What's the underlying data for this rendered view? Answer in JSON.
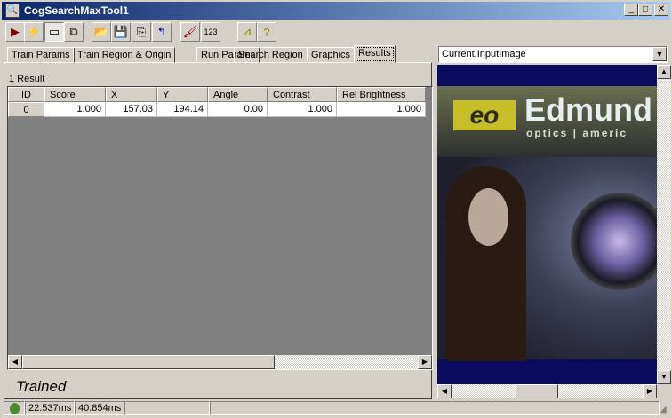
{
  "window": {
    "title": "CogSearchMaxTool1",
    "minimize": "_",
    "maximize": "□",
    "close": "✕"
  },
  "toolbar": [
    {
      "name": "run-icon",
      "glyph": "▶",
      "color": "#800000"
    },
    {
      "name": "electric-icon",
      "glyph": "⚡",
      "color": "#c0a000"
    },
    {
      "name": "show-controls-icon",
      "glyph": "▭",
      "color": "#000"
    },
    {
      "name": "floating-window-icon",
      "glyph": "⧉",
      "color": "#000"
    },
    {
      "name": "open-icon",
      "glyph": "📂",
      "color": "#806000"
    },
    {
      "name": "save-icon",
      "glyph": "💾",
      "color": "#000"
    },
    {
      "name": "save-as-icon",
      "glyph": "⎘",
      "color": "#000"
    },
    {
      "name": "reset-icon",
      "glyph": "↰",
      "color": "#0000a0"
    },
    {
      "name": "clear-icon",
      "glyph": "🖌",
      "color": "#a00000"
    },
    {
      "name": "numeric-display-icon",
      "glyph": "123",
      "color": "#000"
    },
    {
      "name": "edit-tool-icon",
      "glyph": "⊿",
      "color": "#808000"
    },
    {
      "name": "help-icon",
      "glyph": "?",
      "color": "#a08000"
    }
  ],
  "tabs": [
    "Train Params",
    "Train Region & Origin",
    "Run Params",
    "Search Region",
    "Graphics",
    "Results"
  ],
  "active_tab": "Results",
  "results": {
    "count_label": "1 Result",
    "columns": [
      "ID",
      "Score",
      "X",
      "Y",
      "Angle",
      "Contrast",
      "Rel Brightness"
    ],
    "rows": [
      [
        "0",
        "1.000",
        "157.03",
        "194.14",
        "0.00",
        "1.000",
        "1.000"
      ]
    ]
  },
  "status_text": "Trained",
  "image_selector": {
    "value": "Current.InputImage"
  },
  "image": {
    "brand_logo": "eo",
    "brand_text": "Edmund",
    "brand_sub": "optics | americ"
  },
  "statusbar": {
    "indicator_color": "#4c8a2e",
    "time1": "22.537ms",
    "time2": "40.854ms"
  }
}
